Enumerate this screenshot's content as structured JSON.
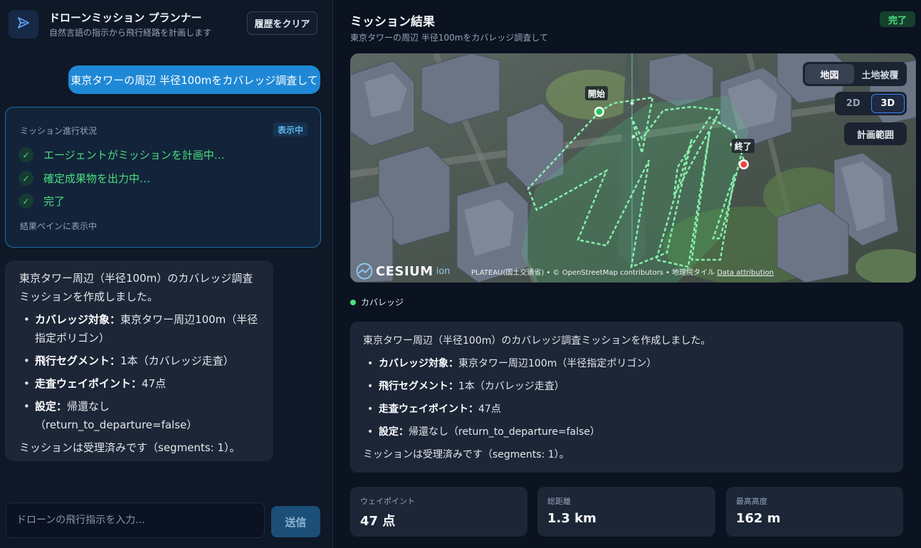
{
  "app": {
    "title": "ドローンミッション プランナー",
    "subtitle": "自然言語の指示から飛行経路を計画します",
    "clear_label": "履歴をクリア"
  },
  "chat": {
    "user_message": "東京タワーの周辺 半径100mをカバレッジ調査して",
    "progress": {
      "title": "ミッション進行状況",
      "badge": "表示中",
      "steps": [
        {
          "label": "エージェントがミッションを計画中…",
          "status": "done"
        },
        {
          "label": "確定成果物を出力中…",
          "status": "done"
        },
        {
          "label": "完了",
          "status": "done"
        }
      ],
      "footer": "結果ペインに表示中"
    },
    "assistant": {
      "intro": "東京タワー周辺（半径100m）のカバレッジ調査ミッションを作成しました。",
      "items": [
        {
          "key": "カバレッジ対象",
          "value": "東京タワー周辺100m（半径指定ポリゴン）"
        },
        {
          "key": "飛行セグメント",
          "value": "1本（カバレッジ走査）"
        },
        {
          "key": "走査ウェイポイント",
          "value": "47点"
        },
        {
          "key": "設定",
          "value": "帰還なし（return_to_departure=false）"
        }
      ],
      "outro": "ミッションは受理済みです（segments: 1）。"
    },
    "input_placeholder": "ドローンの飛行指示を入力...",
    "send_label": "送信"
  },
  "result": {
    "title": "ミッション結果",
    "subtitle": "東京タワーの周辺 半径100mをカバレッジ調査して",
    "status_badge": "完了",
    "map": {
      "layer_buttons": [
        {
          "label": "地図",
          "active": true
        },
        {
          "label": "土地被覆",
          "active": false
        }
      ],
      "dim_buttons": [
        {
          "label": "2D",
          "active": false
        },
        {
          "label": "3D",
          "active": true
        }
      ],
      "extent_label": "計画範囲",
      "start_label": "開始",
      "end_label": "終了",
      "logo_text": "CESIUM",
      "logo_suffix": "ion",
      "attribution": "PLATEAU(国土交通省) • © OpenStreetMap contributors • 地理院タイル",
      "attribution_link": "Data attribution",
      "path_color": "#4ade80"
    },
    "legend_label": "カバレッジ",
    "summary": {
      "intro": "東京タワー周辺（半径100m）のカバレッジ調査ミッションを作成しました。",
      "items": [
        {
          "key": "カバレッジ対象",
          "value": "東京タワー周辺100m（半径指定ポリゴン）"
        },
        {
          "key": "飛行セグメント",
          "value": "1本（カバレッジ走査）"
        },
        {
          "key": "走査ウェイポイント",
          "value": "47点"
        },
        {
          "key": "設定",
          "value": "帰還なし（return_to_departure=false）"
        }
      ],
      "outro": "ミッションは受理済みです（segments: 1）。"
    },
    "stats": [
      {
        "label": "ウェイポイント",
        "value": "47 点"
      },
      {
        "label": "総距離",
        "value": "1.3 km"
      },
      {
        "label": "最高高度",
        "value": "162 m"
      }
    ]
  }
}
